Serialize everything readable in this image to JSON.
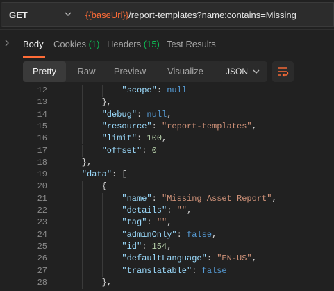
{
  "request": {
    "method": "GET",
    "url_var": "{{baseUrl}}",
    "url_path": "/report-templates?name:contains=Missing"
  },
  "tabs": {
    "body": "Body",
    "cookies": "Cookies",
    "cookies_count": "(1)",
    "headers": "Headers",
    "headers_count": "(15)",
    "test_results": "Test Results"
  },
  "toolbar": {
    "views": [
      "Pretty",
      "Raw",
      "Preview",
      "Visualize"
    ],
    "active_view": "Pretty",
    "format": "JSON"
  },
  "colors": {
    "accent": "#ff6c37",
    "count_green": "#0cbb52"
  },
  "icons": {
    "method_dropdown": "chevron-down-icon",
    "format_dropdown": "chevron-down-icon",
    "wrap": "wrap-lines-icon",
    "sidebar": "chevron-right-icon"
  },
  "code": {
    "lines": [
      {
        "num": "12",
        "indent": 3,
        "parts": [
          [
            "k",
            "\"scope\""
          ],
          [
            "p",
            ": "
          ],
          [
            "kw",
            "null"
          ]
        ]
      },
      {
        "num": "13",
        "indent": 2,
        "parts": [
          [
            "p",
            "},"
          ]
        ]
      },
      {
        "num": "14",
        "indent": 2,
        "parts": [
          [
            "k",
            "\"debug\""
          ],
          [
            "p",
            ": "
          ],
          [
            "kw",
            "null"
          ],
          [
            "p",
            ","
          ]
        ]
      },
      {
        "num": "15",
        "indent": 2,
        "parts": [
          [
            "k",
            "\"resource\""
          ],
          [
            "p",
            ": "
          ],
          [
            "s",
            "\"report-templates\""
          ],
          [
            "p",
            ","
          ]
        ]
      },
      {
        "num": "16",
        "indent": 2,
        "parts": [
          [
            "k",
            "\"limit\""
          ],
          [
            "p",
            ": "
          ],
          [
            "n",
            "100"
          ],
          [
            "p",
            ","
          ]
        ]
      },
      {
        "num": "17",
        "indent": 2,
        "parts": [
          [
            "k",
            "\"offset\""
          ],
          [
            "p",
            ": "
          ],
          [
            "n",
            "0"
          ]
        ]
      },
      {
        "num": "18",
        "indent": 1,
        "parts": [
          [
            "p",
            "},"
          ]
        ]
      },
      {
        "num": "19",
        "indent": 1,
        "parts": [
          [
            "k",
            "\"data\""
          ],
          [
            "p",
            ": ["
          ]
        ]
      },
      {
        "num": "20",
        "indent": 2,
        "parts": [
          [
            "p",
            "{"
          ]
        ]
      },
      {
        "num": "21",
        "indent": 3,
        "parts": [
          [
            "k",
            "\"name\""
          ],
          [
            "p",
            ": "
          ],
          [
            "s",
            "\"Missing Asset Report\""
          ],
          [
            "p",
            ","
          ]
        ]
      },
      {
        "num": "22",
        "indent": 3,
        "parts": [
          [
            "k",
            "\"details\""
          ],
          [
            "p",
            ": "
          ],
          [
            "s",
            "\"\""
          ],
          [
            "p",
            ","
          ]
        ]
      },
      {
        "num": "23",
        "indent": 3,
        "parts": [
          [
            "k",
            "\"tag\""
          ],
          [
            "p",
            ": "
          ],
          [
            "s",
            "\"\""
          ],
          [
            "p",
            ","
          ]
        ]
      },
      {
        "num": "24",
        "indent": 3,
        "parts": [
          [
            "k",
            "\"adminOnly\""
          ],
          [
            "p",
            ": "
          ],
          [
            "kw",
            "false"
          ],
          [
            "p",
            ","
          ]
        ]
      },
      {
        "num": "25",
        "indent": 3,
        "parts": [
          [
            "k",
            "\"id\""
          ],
          [
            "p",
            ": "
          ],
          [
            "n",
            "154"
          ],
          [
            "p",
            ","
          ]
        ]
      },
      {
        "num": "26",
        "indent": 3,
        "parts": [
          [
            "k",
            "\"defaultLanguage\""
          ],
          [
            "p",
            ": "
          ],
          [
            "s",
            "\"EN-US\""
          ],
          [
            "p",
            ","
          ]
        ]
      },
      {
        "num": "27",
        "indent": 3,
        "parts": [
          [
            "k",
            "\"translatable\""
          ],
          [
            "p",
            ": "
          ],
          [
            "kw",
            "false"
          ]
        ]
      },
      {
        "num": "28",
        "indent": 2,
        "parts": [
          [
            "p",
            "},"
          ]
        ]
      }
    ]
  }
}
